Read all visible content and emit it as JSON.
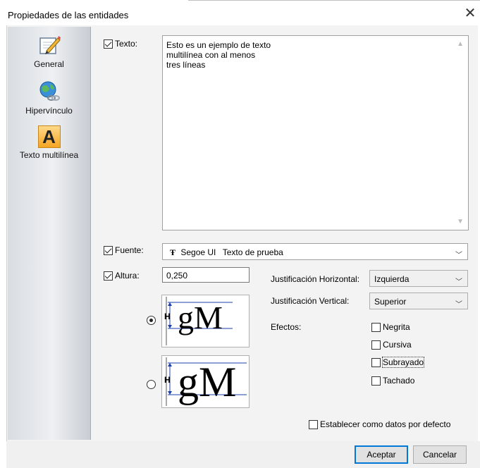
{
  "dialog": {
    "title": "Propiedades de las entidades",
    "close_glyph": "✕"
  },
  "sidebar": {
    "items": [
      {
        "label": "General",
        "icon": "pencil-icon"
      },
      {
        "label": "Hipervínculo",
        "icon": "globe-link-icon"
      },
      {
        "label": "Texto multilínea",
        "icon": "text-a-icon",
        "glyph": "A",
        "selected": true
      }
    ]
  },
  "texto": {
    "checkbox_label": "Texto:",
    "checked": true,
    "lines": [
      "Esto es un ejemplo de texto",
      "multilínea con al menos",
      "tres líneas"
    ]
  },
  "fuente": {
    "checkbox_label": "Fuente:",
    "checked": true,
    "font_icon": "truetype-icon",
    "font_name": "Segoe UI",
    "sample": "Texto de prueba"
  },
  "altura": {
    "checkbox_label": "Altura:",
    "checked": true,
    "value": "0,250"
  },
  "preview": {
    "glyph_text": "gM",
    "marker": "H"
  },
  "justificacion": {
    "horizontal_label": "Justificación Horizontal:",
    "horizontal_value": "Izquierda",
    "vertical_label": "Justificación Vertical:",
    "vertical_value": "Superior"
  },
  "efectos": {
    "label": "Efectos:",
    "options": [
      {
        "label": "Negrita",
        "checked": false
      },
      {
        "label": "Cursiva",
        "checked": false
      },
      {
        "label": "Subrayado",
        "checked": false
      },
      {
        "label": "Tachado",
        "checked": false
      }
    ]
  },
  "default_checkbox": {
    "label": "Establecer como datos por defecto",
    "checked": false
  },
  "buttons": {
    "ok": "Aceptar",
    "cancel": "Cancelar"
  }
}
